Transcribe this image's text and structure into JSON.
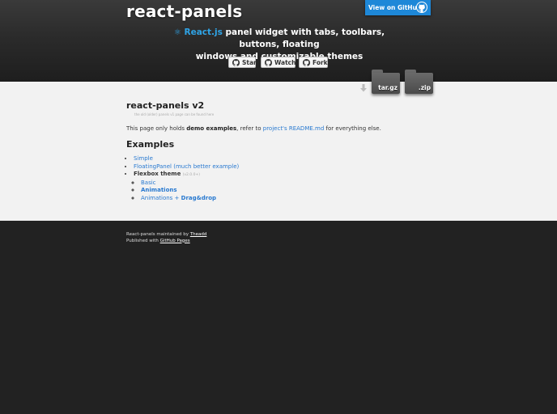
{
  "header": {
    "title": "react-panels",
    "github_button": "View on GitHub",
    "tagline_logo": "⚛",
    "tagline_react": "React.js",
    "tagline_rest1": " panel widget with tabs, toolbars, buttons, floating",
    "tagline_rest2": "windows and customizable themes",
    "social": {
      "star": "Star",
      "watch": "Watch",
      "fork": "Fork"
    },
    "downloads": {
      "targz": "tar.gz",
      "zip": ".zip"
    }
  },
  "main": {
    "heading": "react-panels v2",
    "subnote": "the old (older) panels v1 page can be found here",
    "intro": {
      "before": "This page only holds ",
      "bold": "demo examples",
      "middle": ", refer to ",
      "link": "project's README.md",
      "after": " for everything else."
    },
    "examples_heading": "Examples",
    "examples": {
      "simple": "Simple",
      "floating": "FloatingPanel (much better example)",
      "flexbox": "Flexbox theme",
      "flexbox_note": "(v2.0.0+)",
      "basic": "Basic",
      "animations": "Animations",
      "animations_plus": "Animations + ",
      "dragdrop": "Drag&drop"
    }
  },
  "footer": {
    "line1_text": "React-panels maintained by ",
    "line1_link": "Theadd",
    "line2_text": "Published with ",
    "line2_link": "GitHub Pages"
  },
  "colors": {
    "accent": "#2fa4e7",
    "link": "#2879d0",
    "github_button": "#1e88d8",
    "page_bg": "#222222",
    "content_bg": "#f2f2f2"
  }
}
